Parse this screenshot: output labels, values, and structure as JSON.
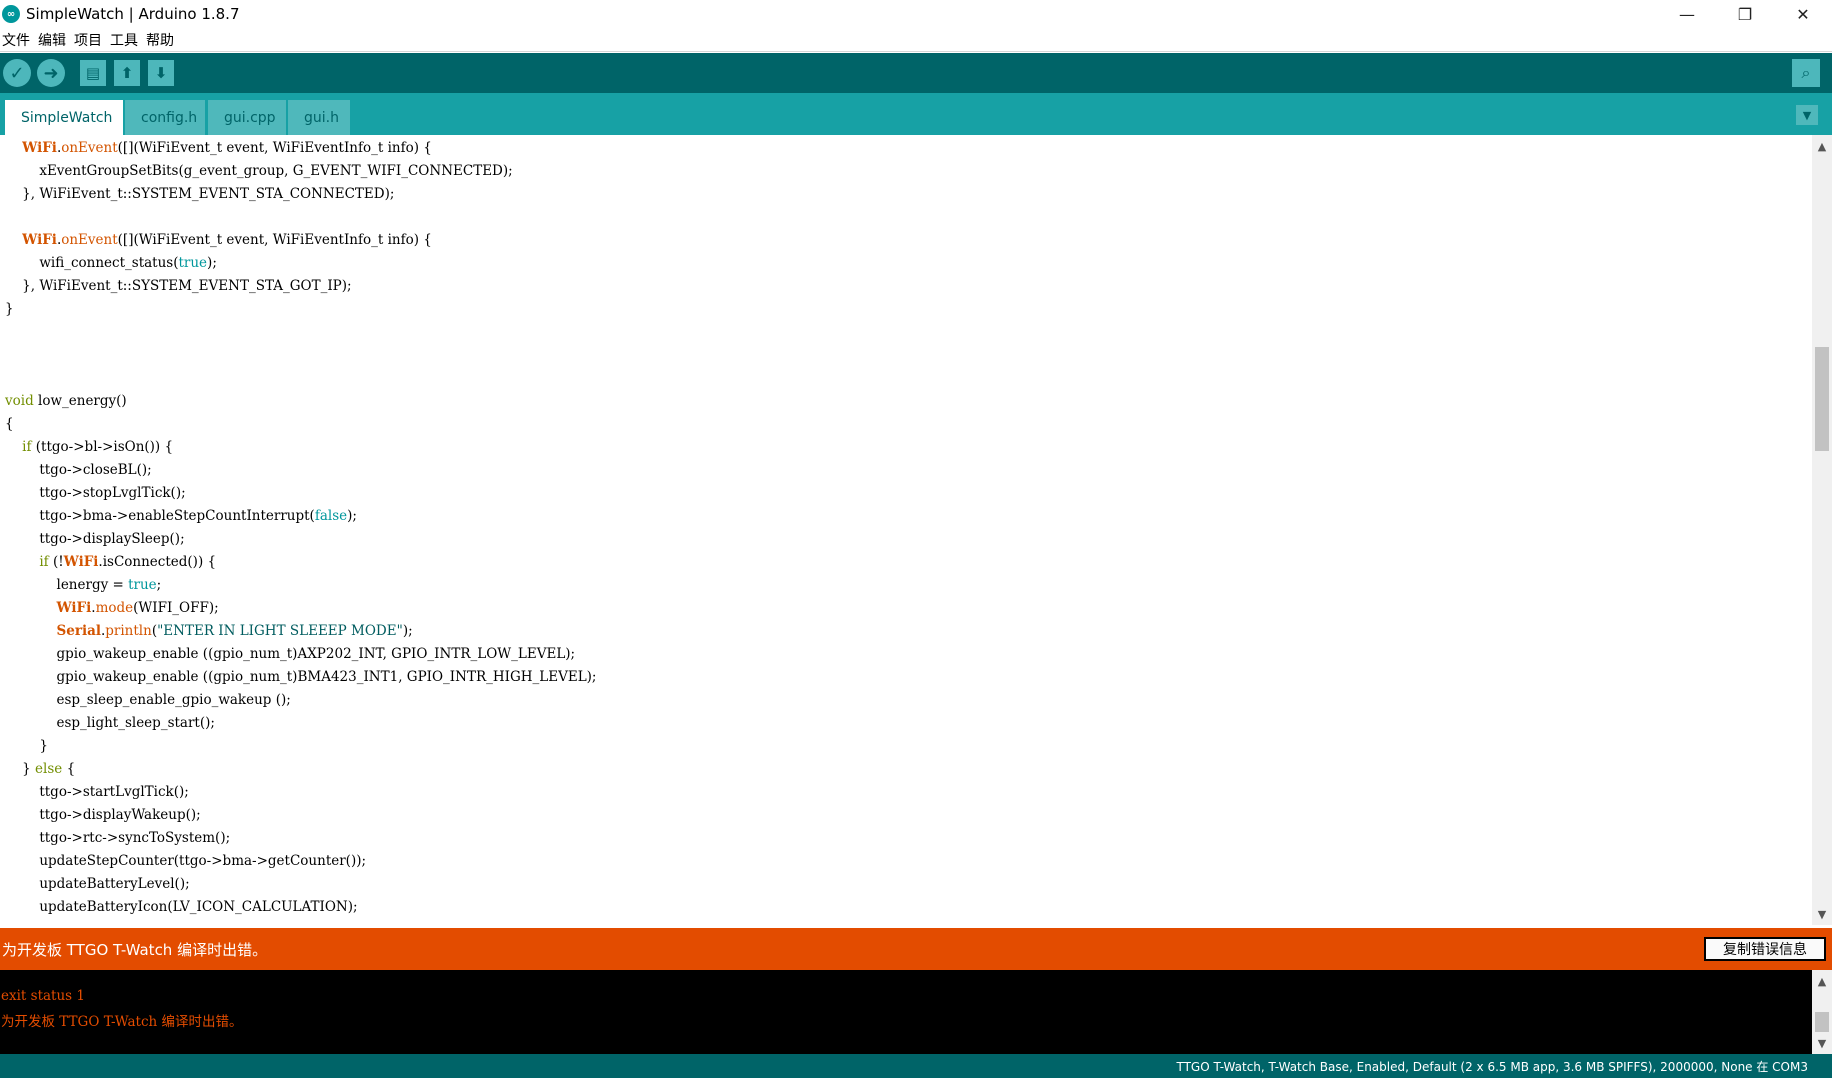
{
  "window": {
    "title": "SimpleWatch | Arduino 1.8.7",
    "logo": "∞",
    "minimize": "—",
    "restore": "❐",
    "close": "✕"
  },
  "menu": [
    "文件",
    "编辑",
    "项目",
    "工具",
    "帮助"
  ],
  "toolbar": {
    "verify_icon": "✓",
    "upload_icon": "➜",
    "new_icon": "▤",
    "open_icon": "⬆",
    "save_icon": "⬇",
    "serial_icon": "⌕"
  },
  "tabs": [
    {
      "label": "SimpleWatch",
      "active": true
    },
    {
      "label": "config.h",
      "active": false
    },
    {
      "label": "gui.cpp",
      "active": false
    },
    {
      "label": "gui.h",
      "active": false
    }
  ],
  "tab_menu_icon": "▼",
  "code": [
    "    WiFi.onEvent([](WiFiEvent_t event, WiFiEventInfo_t info) {",
    "        xEventGroupSetBits(g_event_group, G_EVENT_WIFI_CONNECTED);",
    "    }, WiFiEvent_t::SYSTEM_EVENT_STA_CONNECTED);",
    "",
    "    WiFi.onEvent([](WiFiEvent_t event, WiFiEventInfo_t info) {",
    "        wifi_connect_status(true);",
    "    }, WiFiEvent_t::SYSTEM_EVENT_STA_GOT_IP);",
    "}",
    "",
    "",
    "",
    "void low_energy()",
    "{",
    "    if (ttgo->bl->isOn()) {",
    "        ttgo->closeBL();",
    "        ttgo->stopLvglTick();",
    "        ttgo->bma->enableStepCountInterrupt(false);",
    "        ttgo->displaySleep();",
    "        if (!WiFi.isConnected()) {",
    "            lenergy = true;",
    "            WiFi.mode(WIFI_OFF);",
    "            Serial.println(\"ENTER IN LIGHT SLEEEP MODE\");",
    "            gpio_wakeup_enable ((gpio_num_t)AXP202_INT, GPIO_INTR_LOW_LEVEL);",
    "            gpio_wakeup_enable ((gpio_num_t)BMA423_INT1, GPIO_INTR_HIGH_LEVEL);",
    "            esp_sleep_enable_gpio_wakeup ();",
    "            esp_light_sleep_start();",
    "        }",
    "    } else {",
    "        ttgo->startLvglTick();",
    "        ttgo->displayWakeup();",
    "        ttgo->rtc->syncToSystem();",
    "        updateStepCounter(ttgo->bma->getCounter());",
    "        updateBatteryLevel();",
    "        updateBatteryIcon(LV_ICON_CALCULATION);"
  ],
  "error": {
    "message": "为开发板 TTGO T-Watch 编译时出错。",
    "copy_button": "复制错误信息"
  },
  "console": [
    "exit status 1",
    "为开发板 TTGO T-Watch 编译时出错。"
  ],
  "scroll": {
    "up": "▲",
    "down": "▼"
  },
  "status": "TTGO T-Watch, T-Watch Base, Enabled, Default (2 x 6.5 MB app, 3.6 MB SPIFFS), 2000000, None 在 COM3",
  "colors": {
    "teal_dark": "#006468",
    "teal_mid": "#17a1a5",
    "error_orange": "#e34c00"
  }
}
